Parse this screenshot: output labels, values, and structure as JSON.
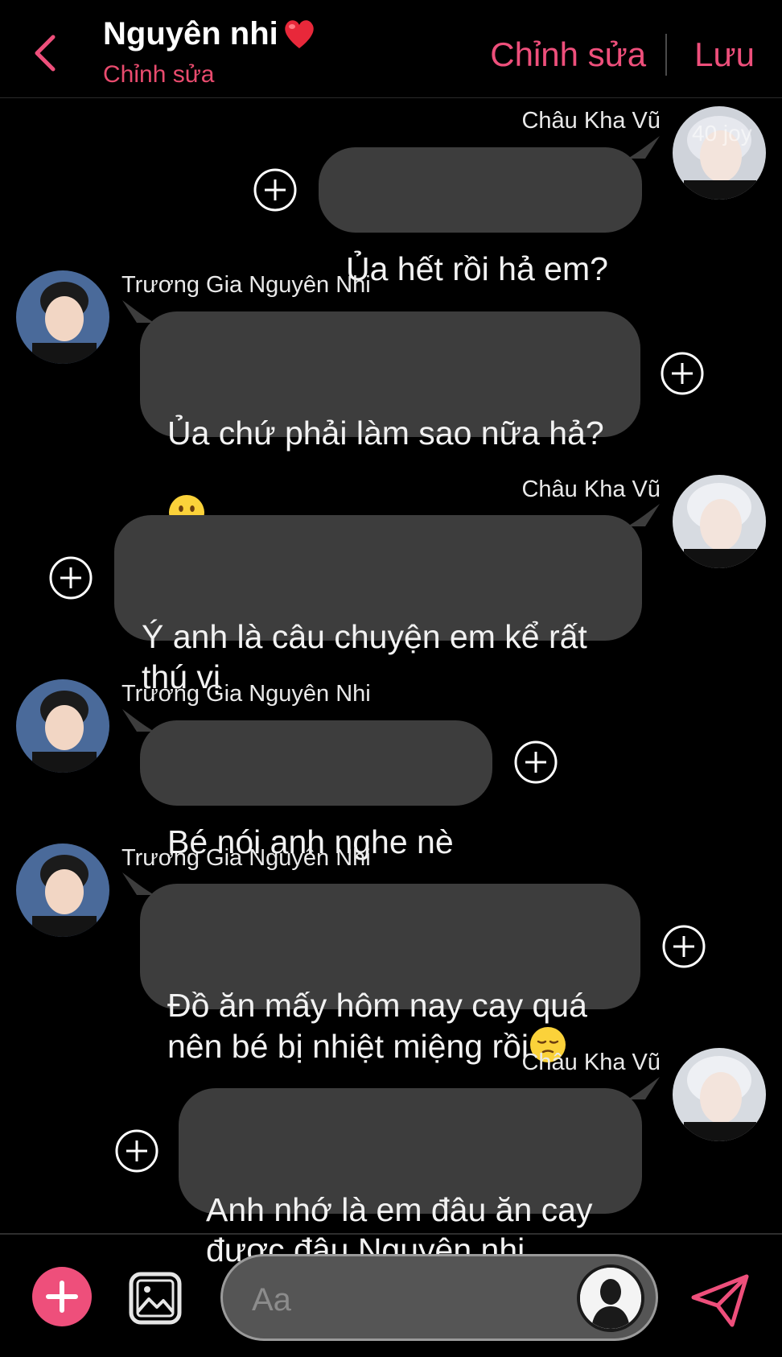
{
  "header": {
    "title": "Nguyên nhi",
    "subtitle": "Chỉnh sửa",
    "edit_label": "Chỉnh sửa",
    "save_label": "Lưu"
  },
  "watermark": "40 joy",
  "messages": [
    {
      "sender": "Châu Kha Vũ",
      "side": "right",
      "text": "Ủa hết rồi hả em?"
    },
    {
      "sender": "Trương Gia Nguyên Nhi",
      "side": "left",
      "text": "Ủa chứ phải làm sao nữa hả?",
      "emoji": "slightly-smiling-face"
    },
    {
      "sender": "Châu Kha Vũ",
      "side": "right",
      "text": "Ý anh là câu chuyện em kể rất\nthú vị"
    },
    {
      "sender": "Trương Gia Nguyên Nhi",
      "side": "left",
      "text": "Bé nói anh nghe nè"
    },
    {
      "sender": "Trương Gia Nguyên Nhi",
      "side": "left",
      "text": "Đồ ăn mấy hôm nay cay quá\nnên bé bị nhiệt miệng rồi",
      "emoji": "pensive-face"
    },
    {
      "sender": "Châu Kha Vũ",
      "side": "right",
      "text": "Anh nhớ là em đâu ăn cay\nđược đâu Nguyên nhi"
    }
  ],
  "composer": {
    "placeholder": "Aa"
  },
  "colors": {
    "accent": "#ee4f7b",
    "bubble": "#3d3d3d",
    "background": "#000000"
  }
}
